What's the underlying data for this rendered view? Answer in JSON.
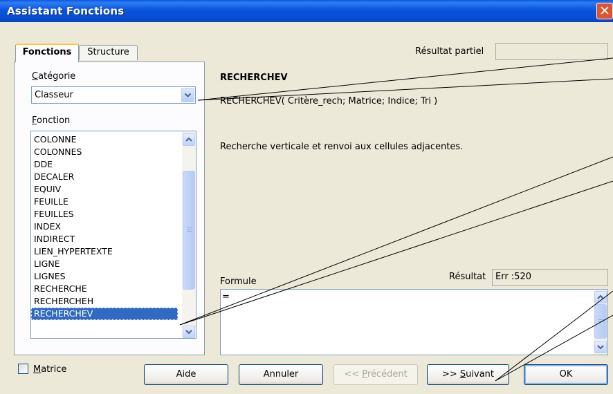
{
  "window": {
    "title": "Assistant Fonctions",
    "close_glyph": "✕"
  },
  "tabs": [
    {
      "label": "Fonctions"
    },
    {
      "label": "Structure"
    }
  ],
  "category": {
    "label": "Catégorie",
    "value": "Classeur"
  },
  "function_list": {
    "label": "Fonction",
    "items": [
      "COLONNE",
      "COLONNES",
      "DDE",
      "DECALER",
      "EQUIV",
      "FEUILLE",
      "FEUILLES",
      "INDEX",
      "INDIRECT",
      "LIEN_HYPERTEXTE",
      "LIGNE",
      "LIGNES",
      "RECHERCHE",
      "RECHERCHEH",
      "RECHERCHEV"
    ],
    "selected": "RECHERCHEV"
  },
  "partial_result": {
    "label": "Résultat partiel",
    "value": ""
  },
  "function_info": {
    "name": "RECHERCHEV",
    "syntax": "RECHERCHEV( Critère_rech; Matrice; Indice; Tri )",
    "description": "Recherche verticale et renvoi aux cellules adjacentes."
  },
  "formula": {
    "label": "Formule",
    "value": "="
  },
  "result": {
    "label": "Résultat",
    "value": "Err :520"
  },
  "matrix": {
    "label": "Matrice",
    "checked": false
  },
  "buttons": {
    "help": "Aide",
    "cancel": "Annuler",
    "previous": "<< Précédent",
    "next": ">> Suivant",
    "ok": "OK"
  },
  "colors": {
    "titlebar": "#0a5ae0",
    "dialog_bg": "#ece9d8",
    "selection": "#316ac5",
    "close_button": "#e0532f"
  }
}
